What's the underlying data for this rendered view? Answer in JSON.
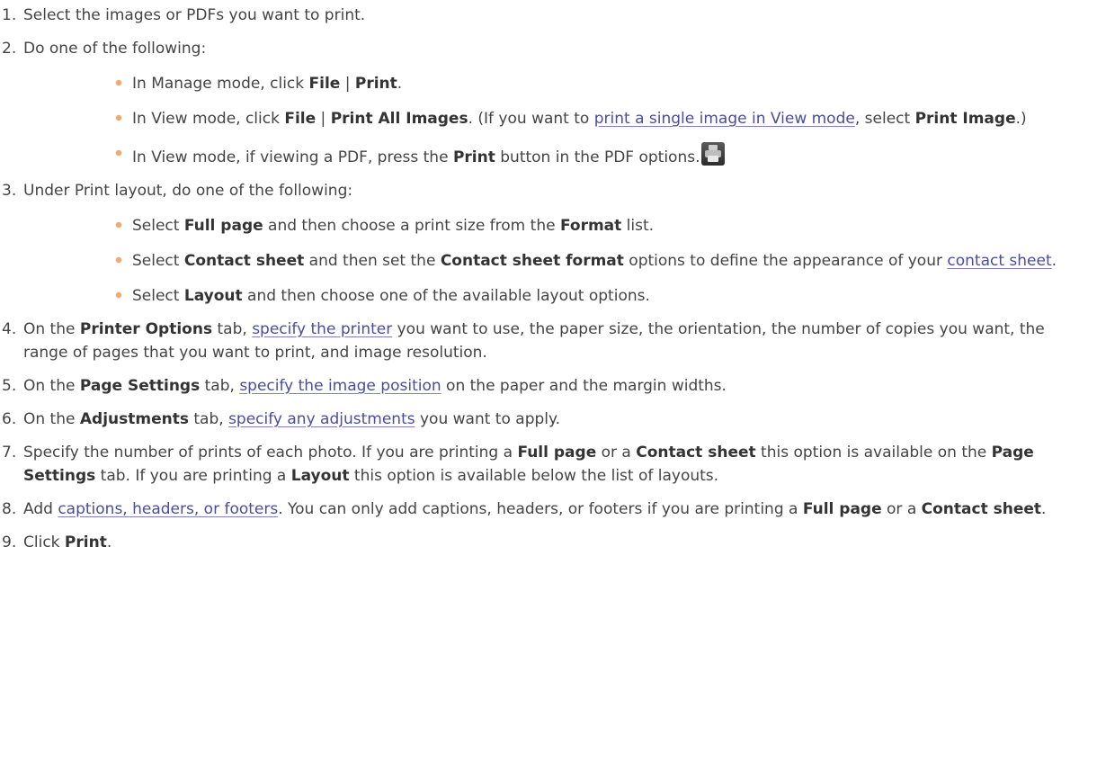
{
  "steps": [
    {
      "num": "1.",
      "parts": [
        {
          "t": "Select the images or PDFs you want to print."
        }
      ]
    },
    {
      "num": "2.",
      "parts": [
        {
          "t": "Do one of the following:"
        }
      ],
      "subs": [
        [
          {
            "t": "In Manage mode, click "
          },
          {
            "b": "File"
          },
          {
            "t": " | "
          },
          {
            "b": "Print"
          },
          {
            "t": "."
          }
        ],
        [
          {
            "t": "In View mode, click "
          },
          {
            "b": "File"
          },
          {
            "t": " | "
          },
          {
            "b": "Print All Images"
          },
          {
            "t": ". (If you want to "
          },
          {
            "a": "print a single image in View mode"
          },
          {
            "t": ", select "
          },
          {
            "b": "Print Image"
          },
          {
            "t": ".)"
          }
        ],
        [
          {
            "t": "In View mode, if viewing a PDF, press the "
          },
          {
            "b": "Print"
          },
          {
            "t": " button in the PDF options."
          },
          {
            "icon": "print-icon"
          }
        ]
      ]
    },
    {
      "num": "3.",
      "parts": [
        {
          "t": "Under Print layout, do one of the following:"
        }
      ],
      "subs": [
        [
          {
            "t": "Select "
          },
          {
            "b": "Full page"
          },
          {
            "t": " and then choose a print size from the "
          },
          {
            "b": "Format"
          },
          {
            "t": " list."
          }
        ],
        [
          {
            "t": "Select "
          },
          {
            "b": "Contact sheet"
          },
          {
            "t": " and then set the "
          },
          {
            "b": "Contact sheet format"
          },
          {
            "t": " options to define the appearance of your "
          },
          {
            "a": "contact sheet"
          },
          {
            "t": "."
          }
        ],
        [
          {
            "t": "Select "
          },
          {
            "b": "Layout"
          },
          {
            "t": " and then choose one of the available layout options."
          }
        ]
      ]
    },
    {
      "num": "4.",
      "parts": [
        {
          "t": "On the "
        },
        {
          "b": "Printer Options"
        },
        {
          "t": " tab, "
        },
        {
          "a": "specify the printer"
        },
        {
          "t": " you want to use, the paper size, the orientation, the number of copies you want, the range of pages that you want to print, and image resolution."
        }
      ]
    },
    {
      "num": "5.",
      "parts": [
        {
          "t": "On the "
        },
        {
          "b": "Page Settings"
        },
        {
          "t": " tab, "
        },
        {
          "a": "specify the image position"
        },
        {
          "t": " on the paper and the margin widths."
        }
      ]
    },
    {
      "num": "6.",
      "parts": [
        {
          "t": "On the "
        },
        {
          "b": "Adjustments"
        },
        {
          "t": " tab, "
        },
        {
          "a": "specify any adjustments"
        },
        {
          "t": " you want to apply."
        }
      ]
    },
    {
      "num": "7.",
      "parts": [
        {
          "t": "Specify the number of prints of each photo. If you are printing a "
        },
        {
          "b": "Full page"
        },
        {
          "t": " or a "
        },
        {
          "b": "Contact sheet"
        },
        {
          "t": " this option is available on the "
        },
        {
          "b": "Page Settings"
        },
        {
          "t": " tab. If you are printing a "
        },
        {
          "b": "Layout"
        },
        {
          "t": " this option is available below the list of layouts."
        }
      ]
    },
    {
      "num": "8.",
      "parts": [
        {
          "t": "Add "
        },
        {
          "a": "captions, headers, or footers"
        },
        {
          "t": ". You can only add captions, headers, or footers if you are printing a "
        },
        {
          "b": "Full page"
        },
        {
          "t": " or a "
        },
        {
          "b": "Contact sheet"
        },
        {
          "t": "."
        }
      ]
    },
    {
      "num": "9.",
      "parts": [
        {
          "t": "Click "
        },
        {
          "b": "Print"
        },
        {
          "t": "."
        }
      ]
    }
  ]
}
